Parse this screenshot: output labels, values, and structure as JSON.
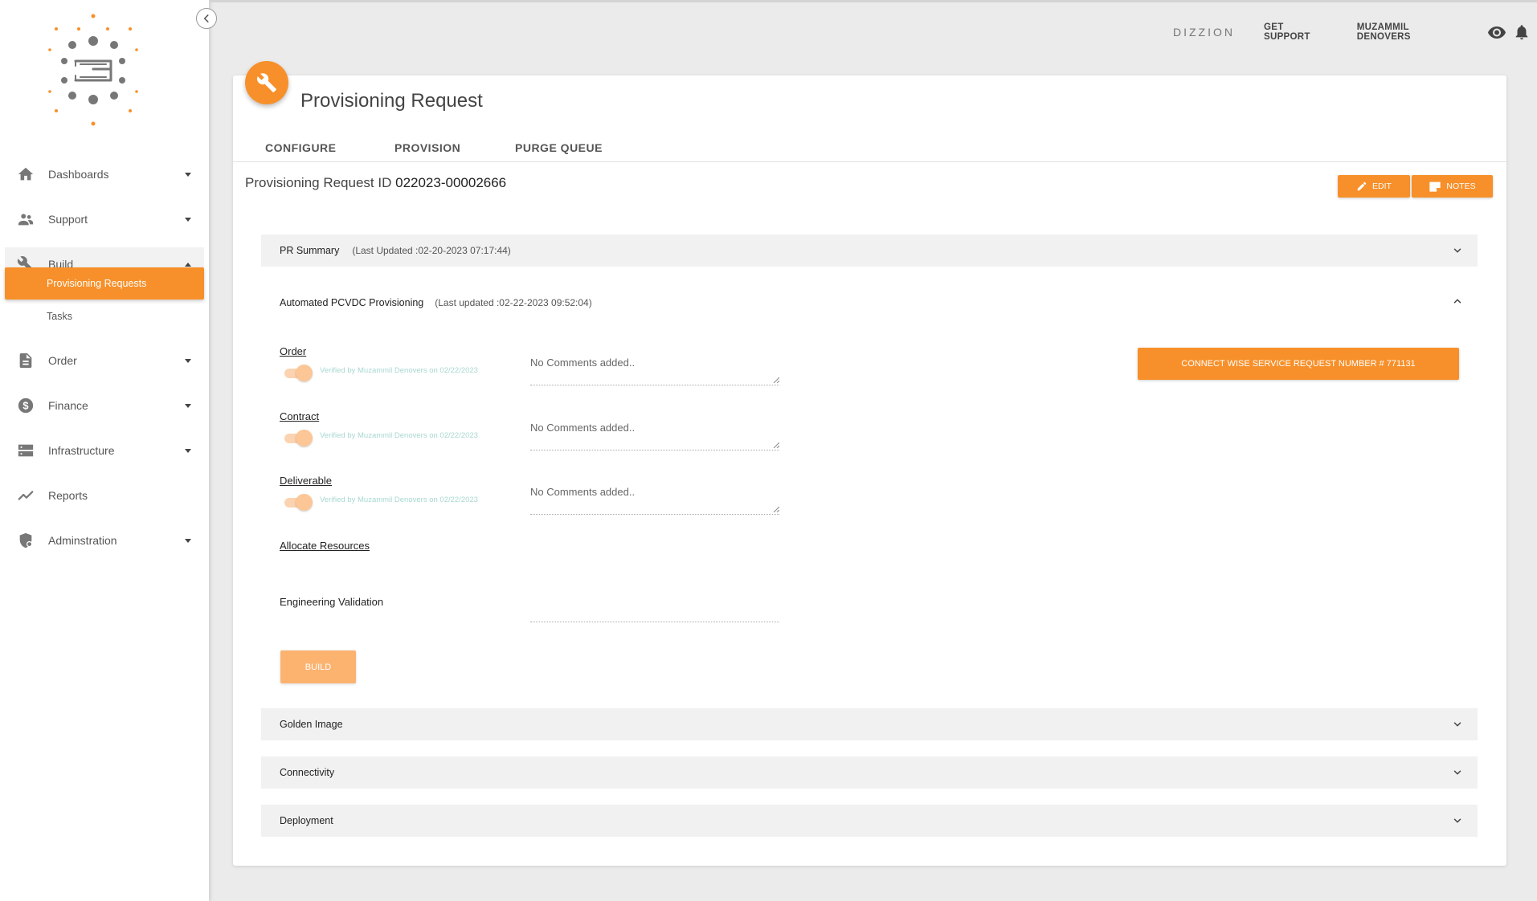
{
  "sidebar": {
    "items": [
      {
        "label": "Dashboards",
        "icon": "home-icon"
      },
      {
        "label": "Support",
        "icon": "people-icon"
      },
      {
        "label": "Build",
        "icon": "wrench-icon"
      },
      {
        "label": "Order",
        "icon": "document-icon"
      },
      {
        "label": "Finance",
        "icon": "dollar-icon"
      },
      {
        "label": "Infrastructure",
        "icon": "server-icon"
      },
      {
        "label": "Reports",
        "icon": "trend-icon"
      },
      {
        "label": "Adminstration",
        "icon": "shield-icon"
      }
    ],
    "build_sub": [
      {
        "label": "Provisioning Requests",
        "active": true
      },
      {
        "label": "Tasks",
        "active": false
      }
    ]
  },
  "header": {
    "brand": "DIZZION",
    "support": "GET SUPPORT",
    "user": "MUZAMMIL DENOVERS"
  },
  "page": {
    "title": "Provisioning Request",
    "tabs": [
      "CONFIGURE",
      "PROVISION",
      "PURGE QUEUE"
    ],
    "id_label": "Provisioning Request ID",
    "id_value": "022023-00002666",
    "edit_label": "EDIT",
    "notes_label": "NOTES"
  },
  "panels": {
    "summary": {
      "title": "PR Summary",
      "sub": "(Last Updated :02-20-2023 07:17:44)"
    },
    "automated": {
      "title": "Automated PCVDC Provisioning",
      "sub": "(Last updated :02-22-2023 09:52:04)"
    },
    "golden": {
      "title": "Golden Image"
    },
    "connectivity": {
      "title": "Connectivity"
    },
    "deployment": {
      "title": "Deployment"
    }
  },
  "steps": {
    "order": {
      "label": "Order",
      "verified": "Verified by Muzammil Denovers on 02/22/2023",
      "comment": "No Comments added.."
    },
    "contract": {
      "label": "Contract",
      "verified": "Verified by Muzammil Denovers on 02/22/2023",
      "comment": "No Comments added.."
    },
    "deliverable": {
      "label": "Deliverable",
      "verified": "Verified by Muzammil Denovers on 02/22/2023",
      "comment": "No Comments added.."
    },
    "allocate": {
      "label": "Allocate Resources"
    },
    "engineering": {
      "label": "Engineering Validation"
    },
    "build_label": "BUILD",
    "connect_label": "CONNECT WISE SERVICE REQUEST NUMBER # 771131"
  },
  "colors": {
    "accent": "#f7902a",
    "accent_light": "#fcb370",
    "verified_text": "#a8d8d0"
  }
}
